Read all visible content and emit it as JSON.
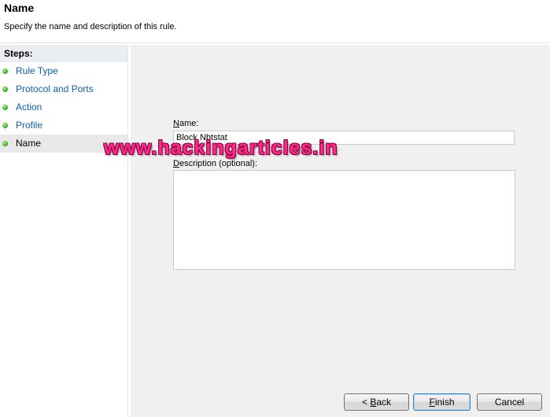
{
  "header": {
    "title": "Name",
    "subtitle": "Specify the name and description of this rule."
  },
  "sidebar": {
    "title": "Steps:",
    "items": [
      {
        "label": "Rule Type"
      },
      {
        "label": "Protocol and Ports"
      },
      {
        "label": "Action"
      },
      {
        "label": "Profile"
      },
      {
        "label": "Name"
      }
    ]
  },
  "form": {
    "name_label_mnemonic": "N",
    "name_label_rest": "ame:",
    "name_value": "Block Nbtstat",
    "description_label_mnemonic": "D",
    "description_label_rest": "escription (optional):",
    "description_value": ""
  },
  "watermark": "www.hackingarticles.in",
  "buttons": {
    "back_prefix": "< ",
    "back_mnemonic": "B",
    "back_rest": "ack",
    "finish_mnemonic": "F",
    "finish_rest": "inish",
    "cancel": "Cancel"
  },
  "colors": {
    "link": "#0b5fb0",
    "content_bg": "#f0f0f0",
    "steps_header_bg": "#eaedf1",
    "active_item_bg": "#e8e8e8",
    "step_dot": "#3fb82a",
    "watermark": "#ff2a8a"
  }
}
